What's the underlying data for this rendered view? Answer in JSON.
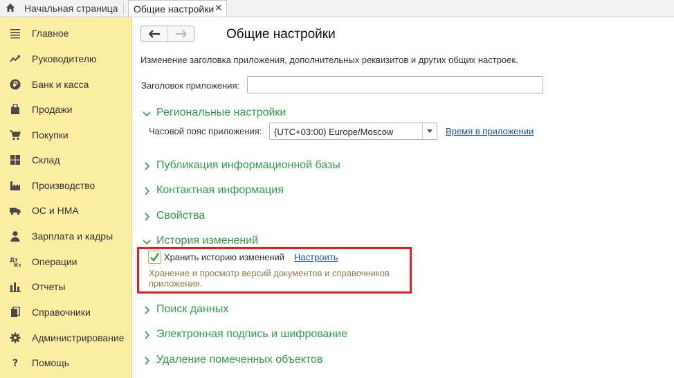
{
  "tabs": {
    "home_label": "Начальная страница",
    "active_label": "Общие настройки",
    "close_glyph": "✕"
  },
  "sidebar": {
    "items": [
      {
        "label": "Главное",
        "icon": "menu-lines-icon"
      },
      {
        "label": "Руководителю",
        "icon": "trend-icon"
      },
      {
        "label": "Банк и касса",
        "icon": "ruble-coin-icon"
      },
      {
        "label": "Продажи",
        "icon": "shopping-bag-icon"
      },
      {
        "label": "Покупки",
        "icon": "cart-icon"
      },
      {
        "label": "Склад",
        "icon": "warehouse-grid-icon"
      },
      {
        "label": "Производство",
        "icon": "factory-icon"
      },
      {
        "label": "ОС и НМА",
        "icon": "truck-icon"
      },
      {
        "label": "Зарплата и кадры",
        "icon": "person-icon"
      },
      {
        "label": "Операции",
        "icon": "operations-icon"
      },
      {
        "label": "Отчеты",
        "icon": "bar-chart-icon"
      },
      {
        "label": "Справочники",
        "icon": "books-icon"
      },
      {
        "label": "Администрирование",
        "icon": "gear-icon"
      },
      {
        "label": "Помощь",
        "icon": "question-icon"
      }
    ]
  },
  "main": {
    "title": "Общие настройки",
    "description": "Изменение заголовка приложения, дополнительных реквизитов и других общих настроек.",
    "app_name_label": "Заголовок приложения:",
    "app_name_value": "",
    "regional": {
      "title": "Региональные настройки",
      "tz_label": "Часовой пояс приложения:",
      "tz_value": "(UTC+03:00) Europe/Moscow",
      "tz_link": "Время в приложении"
    },
    "sections": {
      "publication": "Публикация информационной базы",
      "contact": "Контактная информация",
      "properties": "Свойства",
      "history": "История изменений",
      "search": "Поиск данных",
      "signature": "Электронная подпись и шифрование",
      "deletion": "Удаление помеченных объектов"
    },
    "history": {
      "checkbox_label": "Хранить историю изменений",
      "checked": true,
      "setup_link": "Настроить",
      "hint": "Хранение и просмотр версий документов и справочников приложения."
    }
  },
  "colors": {
    "sidebar_bg": "#fbeda2",
    "section_green": "#2e9f48",
    "link_blue": "#1a4fa3",
    "highlight_red": "#e3201f",
    "hint_text": "#8c7b4d"
  }
}
